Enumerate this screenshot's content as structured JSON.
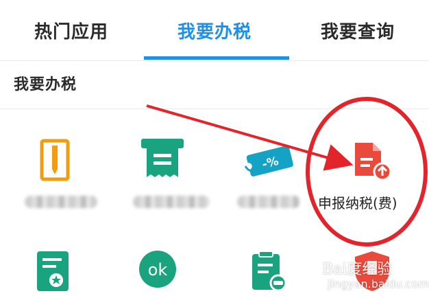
{
  "tabs": [
    {
      "label": "热门应用",
      "active": false
    },
    {
      "label": "我要办税",
      "active": true
    },
    {
      "label": "我要查询",
      "active": false
    }
  ],
  "section": {
    "title": "我要办税"
  },
  "grid": {
    "row1": [
      {
        "icon": "pen-document-icon",
        "label": ""
      },
      {
        "icon": "receipt-printer-icon",
        "label": ""
      },
      {
        "icon": "discount-ticket-icon",
        "label": ""
      },
      {
        "icon": "tax-declaration-upload-icon",
        "label": "申报纳税(费)"
      }
    ],
    "row2": [
      {
        "icon": "certificate-icon",
        "label": ""
      },
      {
        "icon": "ok-badge-icon",
        "label": "ok"
      },
      {
        "icon": "clipboard-car-icon",
        "label": ""
      },
      {
        "icon": "shield-icon",
        "label": ""
      }
    ]
  },
  "watermark": {
    "brand": "Bai度经验",
    "url": "jingyan.baidu.com"
  },
  "colors": {
    "accent": "#1e90e6",
    "orange": "#f39c12",
    "green": "#1aa37f",
    "teal": "#14a3c4",
    "red": "#ea4a3b",
    "annotation_red": "#e3242b"
  }
}
